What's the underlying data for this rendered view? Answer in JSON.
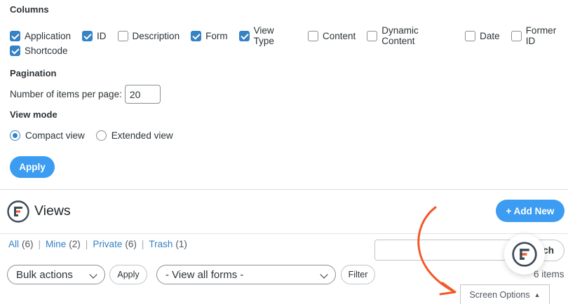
{
  "columns": {
    "title": "Columns",
    "row1": [
      {
        "label": "Application",
        "checked": true
      },
      {
        "label": "ID",
        "checked": true
      },
      {
        "label": "Description",
        "checked": false
      },
      {
        "label": "Form",
        "checked": true
      },
      {
        "label": "View Type",
        "checked": true
      },
      {
        "label": "Content",
        "checked": false
      },
      {
        "label": "Dynamic Content",
        "checked": false
      },
      {
        "label": "Date",
        "checked": false
      },
      {
        "label": "Former ID",
        "checked": false
      }
    ],
    "row2": [
      {
        "label": "Shortcode",
        "checked": true
      }
    ]
  },
  "pagination": {
    "title": "Pagination",
    "label": "Number of items per page:",
    "value": "20"
  },
  "view_mode": {
    "title": "View mode",
    "options": [
      {
        "label": "Compact view",
        "checked": true
      },
      {
        "label": "Extended view",
        "checked": false
      }
    ]
  },
  "apply_label": "Apply",
  "header": {
    "title": "Views",
    "add_new_label": "+ Add New"
  },
  "filters": {
    "all": {
      "label": "All",
      "count": "(6)"
    },
    "mine": {
      "label": "Mine",
      "count": "(2)"
    },
    "private": {
      "label": "Private",
      "count": "(6)"
    },
    "trash": {
      "label": "Trash",
      "count": "(1)"
    },
    "separator": "|"
  },
  "search": {
    "value": "",
    "button_label": "ch"
  },
  "tablenav": {
    "bulk_actions": "Bulk actions",
    "apply_label": "Apply",
    "forms_filter": "- View all forms -",
    "filter_label": "Filter",
    "items_count": "6 items"
  },
  "screen_options_tab": {
    "label": "Screen Options",
    "indicator": "▲"
  },
  "colors": {
    "accent": "#3b9cf2",
    "checkbox": "#3582c4",
    "link": "#3582c4",
    "arrow": "#f05a28"
  }
}
